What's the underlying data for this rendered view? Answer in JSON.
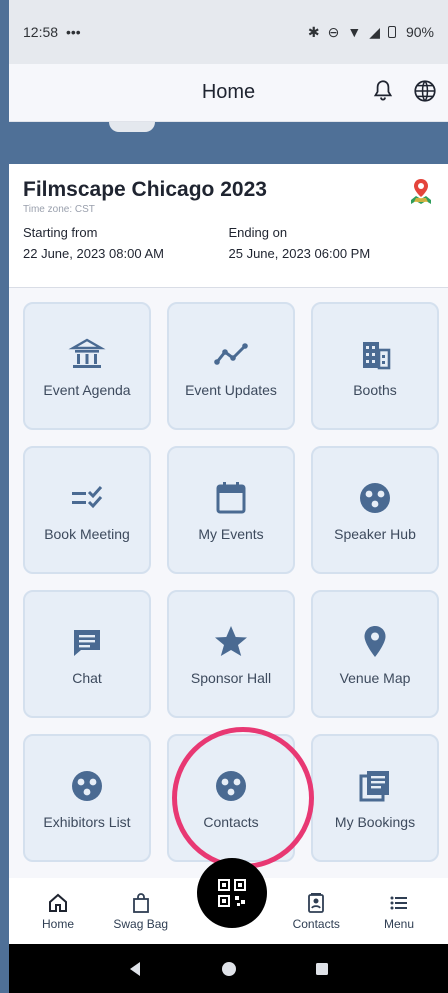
{
  "status": {
    "time": "12:58",
    "dots": "•••",
    "battery": "90%"
  },
  "header": {
    "title": "Home"
  },
  "event": {
    "name": "Filmscape Chicago 2023",
    "timezone": "Time zone: CST",
    "start_label": "Starting from",
    "start_value": "22 June, 2023   08:00 AM",
    "end_label": "Ending on",
    "end_value": "25 June, 2023   06:00 PM"
  },
  "tiles": [
    {
      "label": "Event Agenda",
      "icon": "bank-icon"
    },
    {
      "label": "Event Updates",
      "icon": "trend-icon"
    },
    {
      "label": "Booths",
      "icon": "building-icon"
    },
    {
      "label": "Book Meeting",
      "icon": "checklist-icon"
    },
    {
      "label": "My Events",
      "icon": "calendar-icon"
    },
    {
      "label": "Speaker Hub",
      "icon": "group-icon"
    },
    {
      "label": "Chat",
      "icon": "chat-icon"
    },
    {
      "label": "Sponsor Hall",
      "icon": "star-icon"
    },
    {
      "label": "Venue Map",
      "icon": "location-pin-icon"
    },
    {
      "label": "Exhibitors List",
      "icon": "group-icon"
    },
    {
      "label": "Contacts",
      "icon": "group-icon"
    },
    {
      "label": "My Bookings",
      "icon": "documents-icon"
    }
  ],
  "bottom_nav": [
    {
      "label": "Home",
      "icon": "home-icon"
    },
    {
      "label": "Swag Bag",
      "icon": "bag-icon"
    },
    {
      "label": "Contacts",
      "icon": "contacts-icon"
    },
    {
      "label": "Menu",
      "icon": "menu-icon"
    }
  ],
  "colors": {
    "banner": "#4f7097",
    "tile_bg": "#e7eef7",
    "tile_icon": "#4a6a92",
    "highlight": "#e83873"
  }
}
